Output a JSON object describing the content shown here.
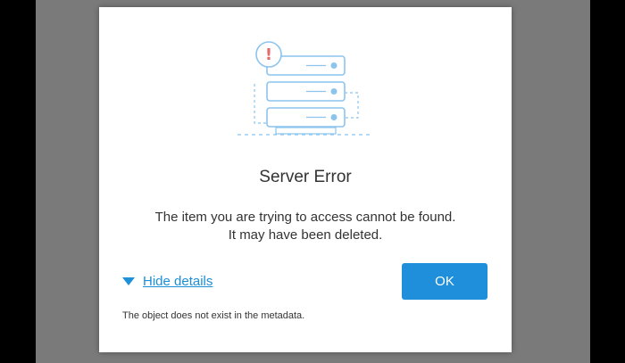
{
  "dialog": {
    "title": "Server Error",
    "message": "The item you are trying to access cannot be found. It may have been deleted.",
    "details_toggle_label": "Hide details",
    "ok_label": "OK",
    "details_text": "The object does not exist in the metadata.",
    "illustration_icon": "server-error-icon",
    "alert_glyph": "!"
  },
  "colors": {
    "accent": "#1f8fdb",
    "alert": "#e36b6b",
    "illustration_stroke": "#8cc4ee",
    "backdrop": "#7a7a7a"
  }
}
